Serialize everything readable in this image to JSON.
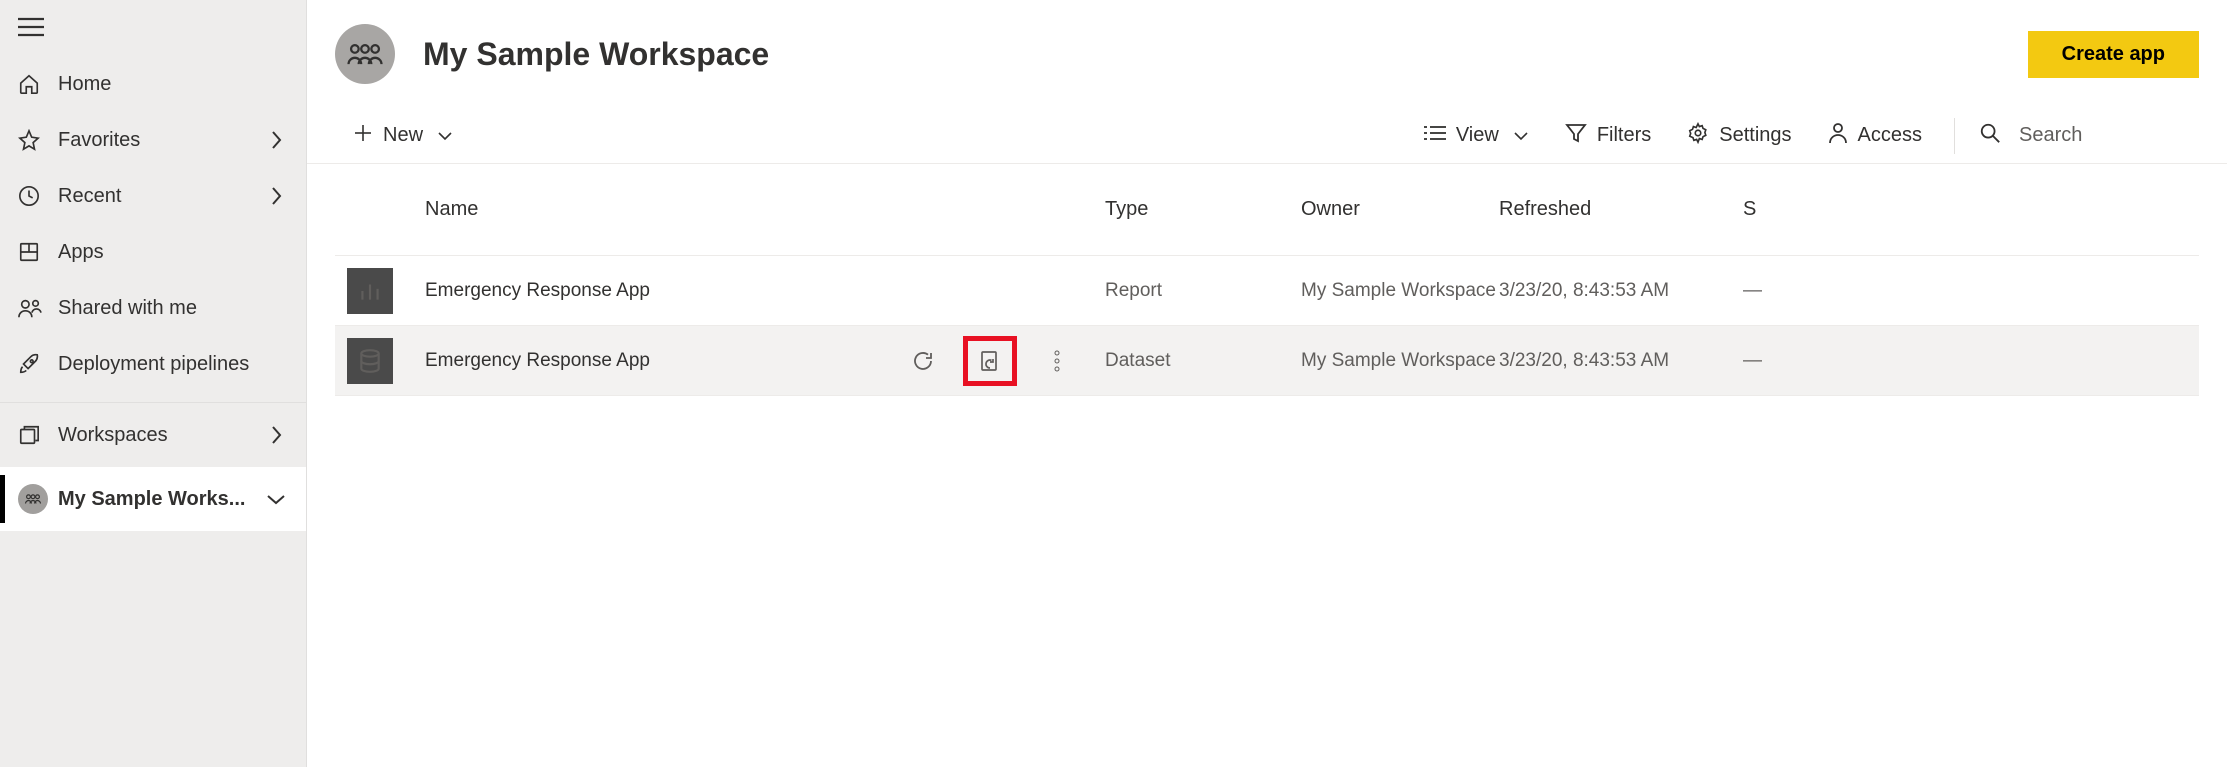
{
  "sidebar": {
    "items": [
      {
        "label": "Home"
      },
      {
        "label": "Favorites"
      },
      {
        "label": "Recent"
      },
      {
        "label": "Apps"
      },
      {
        "label": "Shared with me"
      },
      {
        "label": "Deployment pipelines"
      },
      {
        "label": "Workspaces"
      }
    ],
    "active_workspace_label": "My Sample Works..."
  },
  "header": {
    "title": "My Sample Workspace",
    "create_app_label": "Create app"
  },
  "toolbar": {
    "new_label": "New",
    "view_label": "View",
    "filters_label": "Filters",
    "settings_label": "Settings",
    "access_label": "Access",
    "search_placeholder": "Search"
  },
  "table": {
    "columns": {
      "name": "Name",
      "type": "Type",
      "owner": "Owner",
      "refreshed": "Refreshed",
      "next": "S"
    },
    "rows": [
      {
        "icon": "report-icon",
        "name": "Emergency Response App",
        "type": "Report",
        "owner": "My Sample Workspace",
        "refreshed": "3/23/20, 8:43:53 AM",
        "next": "—",
        "hover": false
      },
      {
        "icon": "dataset-icon",
        "name": "Emergency Response App",
        "type": "Dataset",
        "owner": "My Sample Workspace",
        "refreshed": "3/23/20, 8:43:53 AM",
        "next": "—",
        "hover": true
      }
    ]
  }
}
